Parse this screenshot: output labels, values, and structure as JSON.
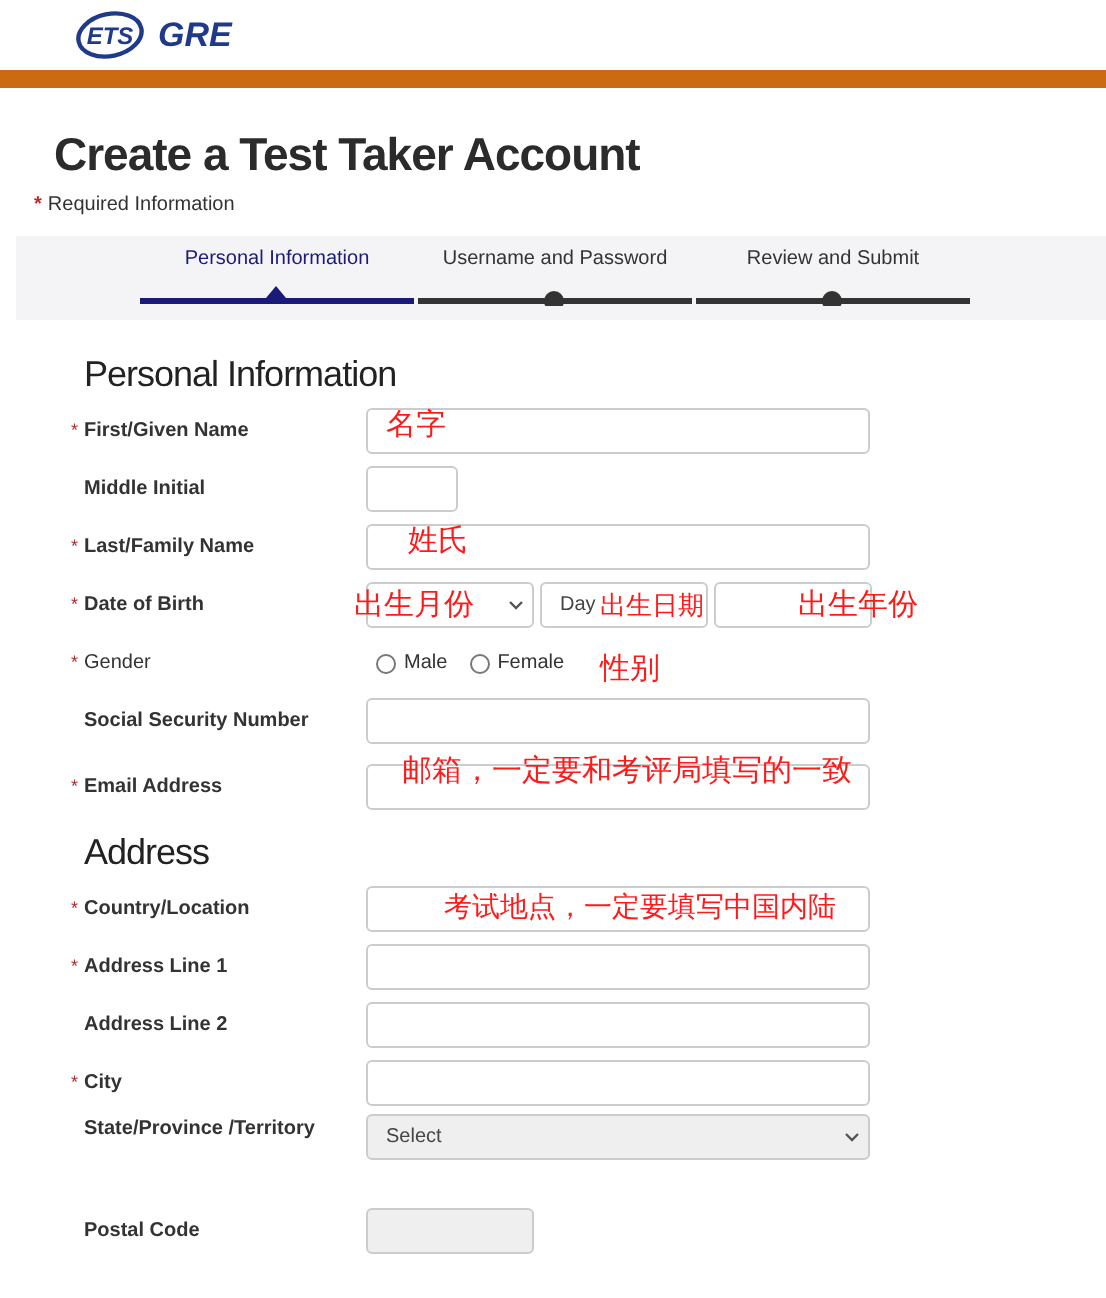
{
  "logo": {
    "ets": "ETS",
    "gre": "GRE"
  },
  "title": "Create a Test Taker Account",
  "required_note": {
    "mark": "*",
    "text": "Required Information"
  },
  "steps": [
    {
      "label": "Personal Information",
      "selected": true
    },
    {
      "label": "Username and Password",
      "selected": false
    },
    {
      "label": "Review and Submit",
      "selected": false
    }
  ],
  "sections": [
    {
      "heading": "Personal Information",
      "fields": [
        {
          "kind": "text",
          "label": "First/Given Name",
          "required": true,
          "note": "名字"
        },
        {
          "kind": "short",
          "label": "Middle Initial",
          "required": false
        },
        {
          "kind": "text",
          "label": "Last/Family Name",
          "required": true,
          "note": "姓氏"
        },
        {
          "kind": "date",
          "label": "Date of Birth",
          "required": true,
          "day": "Day",
          "notes": [
            "出生月份",
            "出生日期",
            "出生年份"
          ]
        },
        {
          "kind": "radio",
          "label": "Gender",
          "required": true,
          "options": [
            {
              "label": "Male",
              "selected": false
            },
            {
              "label": "Female",
              "selected": false
            }
          ],
          "note": "性别"
        },
        {
          "kind": "text",
          "label": "Social Security Number",
          "required": false
        },
        {
          "kind": "text",
          "label": "Email Address",
          "required": true,
          "note": "邮箱，一定要和考评局填写的一致"
        }
      ]
    },
    {
      "heading": "Address",
      "fields": [
        {
          "kind": "text",
          "label": "Country/Location",
          "required": true,
          "note": "考试地点，一定要填写中国内陆"
        },
        {
          "kind": "text",
          "label": "Address Line 1",
          "required": true
        },
        {
          "kind": "text",
          "label": "Address Line 2",
          "required": false
        },
        {
          "kind": "text",
          "label": "City",
          "required": true
        },
        {
          "kind": "select",
          "label": "State/Province /Territory",
          "required": false,
          "value": "Select"
        },
        {
          "kind": "postal",
          "label": "Postal Code",
          "required": false
        }
      ]
    }
  ]
}
